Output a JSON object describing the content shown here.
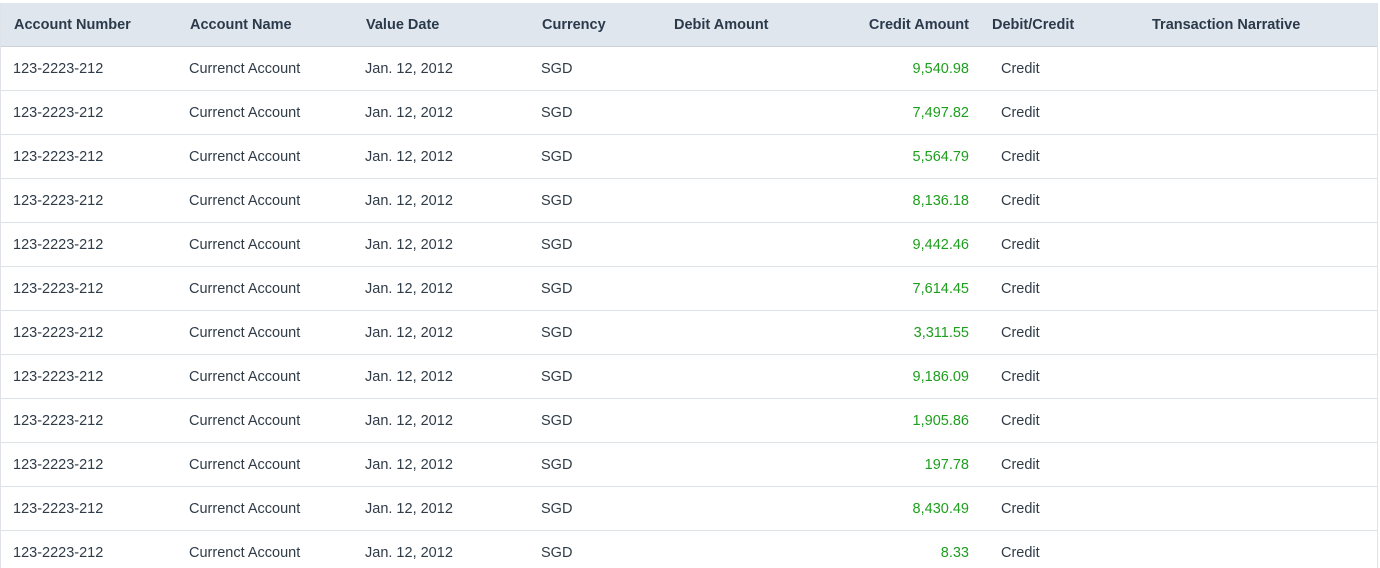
{
  "columns": [
    "Account Number",
    "Account Name",
    "Value Date",
    "Currency",
    "Debit Amount",
    "Credit Amount",
    "Debit/Credit",
    "Transaction Narrative"
  ],
  "rows": [
    {
      "account_number": "123-2223-212",
      "account_name": "Currenct Account",
      "value_date": "Jan. 12, 2012",
      "currency": "SGD",
      "debit_amount": "",
      "credit_amount": "9,540.98",
      "debit_credit": "Credit",
      "narrative": ""
    },
    {
      "account_number": "123-2223-212",
      "account_name": "Currenct Account",
      "value_date": "Jan. 12, 2012",
      "currency": "SGD",
      "debit_amount": "",
      "credit_amount": "7,497.82",
      "debit_credit": "Credit",
      "narrative": ""
    },
    {
      "account_number": "123-2223-212",
      "account_name": "Currenct Account",
      "value_date": "Jan. 12, 2012",
      "currency": "SGD",
      "debit_amount": "",
      "credit_amount": "5,564.79",
      "debit_credit": "Credit",
      "narrative": ""
    },
    {
      "account_number": "123-2223-212",
      "account_name": "Currenct Account",
      "value_date": "Jan. 12, 2012",
      "currency": "SGD",
      "debit_amount": "",
      "credit_amount": "8,136.18",
      "debit_credit": "Credit",
      "narrative": ""
    },
    {
      "account_number": "123-2223-212",
      "account_name": "Currenct Account",
      "value_date": "Jan. 12, 2012",
      "currency": "SGD",
      "debit_amount": "",
      "credit_amount": "9,442.46",
      "debit_credit": "Credit",
      "narrative": ""
    },
    {
      "account_number": "123-2223-212",
      "account_name": "Currenct Account",
      "value_date": "Jan. 12, 2012",
      "currency": "SGD",
      "debit_amount": "",
      "credit_amount": "7,614.45",
      "debit_credit": "Credit",
      "narrative": ""
    },
    {
      "account_number": "123-2223-212",
      "account_name": "Currenct Account",
      "value_date": "Jan. 12, 2012",
      "currency": "SGD",
      "debit_amount": "",
      "credit_amount": "3,311.55",
      "debit_credit": "Credit",
      "narrative": ""
    },
    {
      "account_number": "123-2223-212",
      "account_name": "Currenct Account",
      "value_date": "Jan. 12, 2012",
      "currency": "SGD",
      "debit_amount": "",
      "credit_amount": "9,186.09",
      "debit_credit": "Credit",
      "narrative": ""
    },
    {
      "account_number": "123-2223-212",
      "account_name": "Currenct Account",
      "value_date": "Jan. 12, 2012",
      "currency": "SGD",
      "debit_amount": "",
      "credit_amount": "1,905.86",
      "debit_credit": "Credit",
      "narrative": ""
    },
    {
      "account_number": "123-2223-212",
      "account_name": "Currenct Account",
      "value_date": "Jan. 12, 2012",
      "currency": "SGD",
      "debit_amount": "",
      "credit_amount": "197.78",
      "debit_credit": "Credit",
      "narrative": ""
    },
    {
      "account_number": "123-2223-212",
      "account_name": "Currenct Account",
      "value_date": "Jan. 12, 2012",
      "currency": "SGD",
      "debit_amount": "",
      "credit_amount": "8,430.49",
      "debit_credit": "Credit",
      "narrative": ""
    },
    {
      "account_number": "123-2223-212",
      "account_name": "Currenct Account",
      "value_date": "Jan. 12, 2012",
      "currency": "SGD",
      "debit_amount": "",
      "credit_amount": "8.33",
      "debit_credit": "Credit",
      "narrative": ""
    }
  ],
  "colors": {
    "header_bg": "#dfe6ee",
    "credit_amount": "#1e9e1e",
    "row_border": "#dde2e7"
  }
}
